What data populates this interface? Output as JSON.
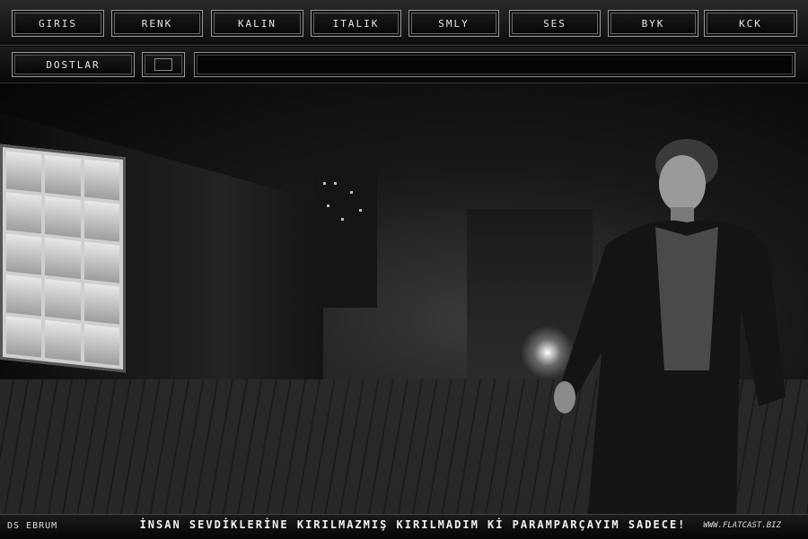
{
  "toolbar": {
    "buttons": [
      {
        "label": "GIRIS"
      },
      {
        "label": "RENK"
      },
      {
        "label": "KALIN"
      },
      {
        "label": "ITALIK"
      },
      {
        "label": "SMLY"
      },
      {
        "label": "SES"
      },
      {
        "label": "BYK"
      },
      {
        "label": "KCK"
      }
    ]
  },
  "toolbar2": {
    "friends_label": "DOSTLAR",
    "message_value": ""
  },
  "footer": {
    "credit": "DS EBRUM",
    "marquee": "İNSAN SEVDİKLERİNE KIRILMAZMIŞ KIRILMADIM Kİ PARAMPARÇAYIM SADECE!",
    "site": "WWW.FLATCAST.BIZ"
  },
  "icons": {
    "blank_button_icon": "square-icon"
  }
}
